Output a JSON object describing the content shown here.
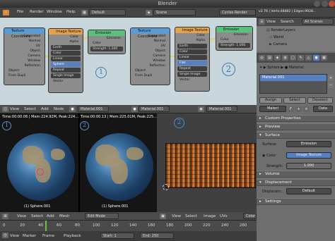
{
  "window": {
    "title": "Blender"
  },
  "info_header": {
    "menus": [
      "File",
      "Render",
      "Window",
      "Help"
    ],
    "screen": "Default",
    "scene": "Scene",
    "engine": "Cycles Render",
    "stats": "v2.76 | Verts:48482 | Edges:9928..."
  },
  "nodes": {
    "left": {
      "tex_coord": {
        "title": "Texture Coordinate",
        "outputs": [
          "Generated",
          "Normal",
          "UV",
          "Object",
          "Camera",
          "Window",
          "Reflection"
        ],
        "object_label": "Object:",
        "dupli": "From Dupli"
      },
      "image_tex": {
        "title": "Image Texture",
        "outputs": [
          "Color",
          "Alpha"
        ],
        "image": "Earth",
        "btn1": "Color",
        "btn2": "Linear",
        "btn3": "Sphere",
        "btn4": "Repeat",
        "btn5": "Single Image",
        "input": "Vector"
      },
      "emission": {
        "title": "Emission",
        "output": "Emission",
        "inputs": [
          "Color"
        ],
        "strength": "Strength: 1.000"
      },
      "mark": "1"
    },
    "right": {
      "tex_coord": {
        "title": "Texture Coordinate",
        "outputs": [
          "Generated",
          "Normal",
          "UV",
          "Object",
          "Camera",
          "Window",
          "Reflection"
        ],
        "object_label": "Object:",
        "dupli": "From Dupli"
      },
      "image_tex": {
        "title": "Image Texture",
        "outputs": [
          "Color",
          "Alpha"
        ],
        "image": "Earth",
        "btn1": "Color",
        "btn2": "Linear",
        "btn3": "Flat",
        "btn4": "Repeat",
        "btn5": "Single Image",
        "input": "Vector"
      },
      "emission": {
        "title": "Emission",
        "output": "Emission",
        "inputs": [
          "Color"
        ],
        "strength": "Strength: 1.000"
      },
      "mark": "2"
    },
    "header": {
      "items": [
        "View",
        "Select",
        "Add",
        "Node"
      ],
      "material": "Material.001"
    }
  },
  "viewport": {
    "left_stats": "Time:00:00.06 | Mem:224.92M, Peak:224...",
    "right_stats": "Time:00:00.13 | Mem:225.01M, Peak:225...",
    "left_label": "(1) Sphere.001",
    "right_label": "(1) Sphere.001",
    "marks": [
      "1",
      "2"
    ],
    "header": {
      "items": [
        "View",
        "Select",
        "Add",
        "Mesh"
      ],
      "mode": "Edit Mode"
    }
  },
  "image_editor": {
    "mark": "2",
    "header": {
      "items": [
        "View",
        "Select",
        "Image",
        "UVs"
      ],
      "tail": "Color M"
    }
  },
  "timeline": {
    "items": [
      "View",
      "Marker",
      "Frame",
      "Playback"
    ],
    "start": "Start:",
    "start_val": "1",
    "end": "End:",
    "end_val": "250",
    "ticks": [
      "0",
      "20",
      "40",
      "60",
      "80",
      "100",
      "120",
      "140",
      "160",
      "180",
      "200",
      "220",
      "240",
      "260"
    ]
  },
  "outliner": {
    "header": {
      "view": "View",
      "search": "Search",
      "scenes": "All Scenes"
    },
    "items": [
      "RenderLayers",
      "World",
      "Camera"
    ]
  },
  "properties": {
    "breadcrumb": {
      "object": "Sphere",
      "material": "Material."
    },
    "slot": "Material.001",
    "buttons": {
      "assign": "Assign",
      "select": "Select",
      "deselect": "Deselect"
    },
    "material_field": "Materi",
    "data_field": "Data",
    "panels": {
      "custom": "Custom Properties",
      "preview": "Preview",
      "surface": "Surface",
      "volume": "Volume",
      "displacement": "Displacement",
      "settings": "Settings"
    },
    "surface": {
      "surface_label": "Surface:",
      "surface_value": "Emission",
      "color_label": "Color:",
      "color_value": "Image Texture",
      "strength_label": "Strength:",
      "strength_value": "1.000"
    },
    "disp": {
      "label": "Displacem...",
      "value": "Default"
    }
  },
  "colors": {
    "node_bg": "#c9d7dc",
    "texcoord_header": "#5c9bd1",
    "image_header": "#e5a24c",
    "emission_header": "#5bc07c",
    "wire": "#d7d35a",
    "annotation": "#3d78b8"
  }
}
